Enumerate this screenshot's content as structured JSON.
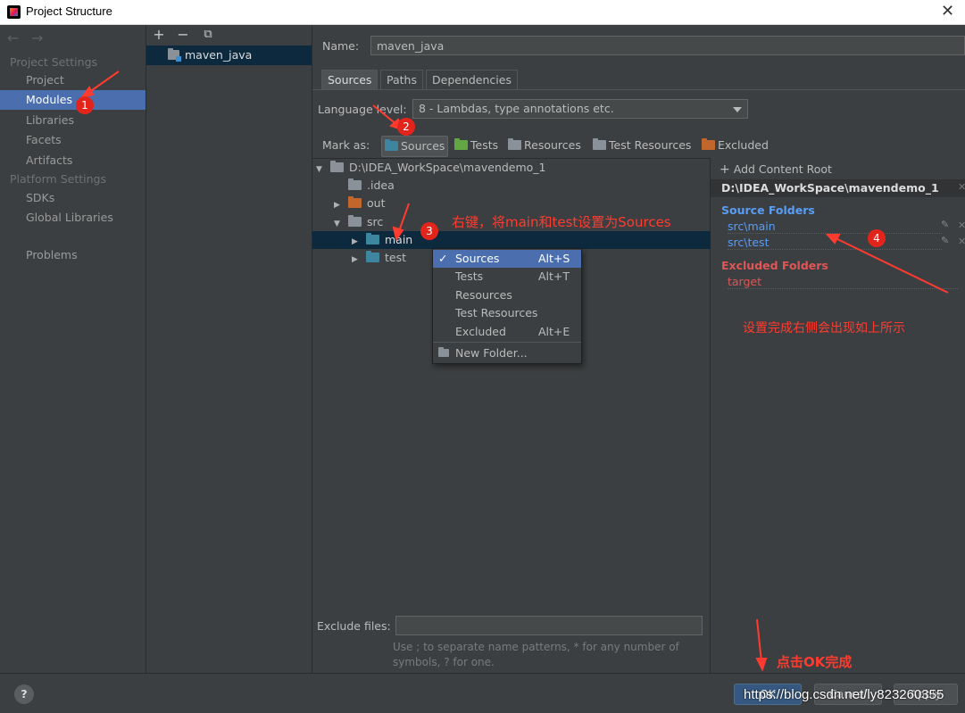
{
  "window": {
    "title": "Project Structure",
    "close_glyph": "✕"
  },
  "nav": {
    "back": "←",
    "forward": "→",
    "project_settings_header": "Project Settings",
    "project_settings_items": [
      "Project",
      "Modules",
      "Libraries",
      "Facets",
      "Artifacts"
    ],
    "platform_settings_header": "Platform Settings",
    "platform_settings_items": [
      "SDKs",
      "Global Libraries"
    ],
    "problems": "Problems",
    "selected": "Modules"
  },
  "modules": {
    "add": "+",
    "remove": "−",
    "copy": "⧉",
    "items": [
      "maven_java"
    ]
  },
  "main": {
    "name_label": "Name:",
    "name_value": "maven_java",
    "tabs": [
      "Sources",
      "Paths",
      "Dependencies"
    ],
    "language_level_label": "Language level:",
    "language_level_value": "8 - Lambdas, type annotations etc.",
    "mark_as_label": "Mark as:",
    "mark_as": [
      "Sources",
      "Tests",
      "Resources",
      "Test Resources",
      "Excluded"
    ],
    "tree": [
      {
        "label": "D:\\IDEA_WorkSpace\\mavendemo_1",
        "toggle": "▼",
        "color": "grey"
      },
      {
        "label": ".idea",
        "toggle": "",
        "color": "grey"
      },
      {
        "label": "out",
        "toggle": "▶",
        "color": "orange"
      },
      {
        "label": "src",
        "toggle": "▼",
        "color": "grey"
      },
      {
        "label": "main",
        "toggle": "▶",
        "color": "blue"
      },
      {
        "label": "test",
        "toggle": "▶",
        "color": "blue"
      }
    ],
    "exclude_label": "Exclude files:",
    "exclude_value": "",
    "exclude_hint_1": "Use ; to separate name patterns, * for any number of",
    "exclude_hint_2": "symbols, ? for one."
  },
  "content_root": {
    "add_label": "Add Content Root",
    "path": "D:\\IDEA_WorkSpace\\mavendemo_1",
    "source_header": "Source Folders",
    "source_items": [
      "src\\main",
      "src\\test"
    ],
    "excluded_header": "Excluded Folders",
    "excluded_items": [
      "target"
    ]
  },
  "context_menu": {
    "items": [
      {
        "label": "Sources",
        "shortcut": "Alt+S",
        "checked": "✓"
      },
      {
        "label": "Tests",
        "shortcut": "Alt+T",
        "checked": ""
      },
      {
        "label": "Resources",
        "shortcut": "",
        "checked": ""
      },
      {
        "label": "Test Resources",
        "shortcut": "",
        "checked": ""
      },
      {
        "label": "Excluded",
        "shortcut": "Alt+E",
        "checked": ""
      }
    ],
    "new_folder": "New Folder..."
  },
  "footer": {
    "help": "?",
    "ok": "OK",
    "cancel": "Cancel",
    "apply": "Apply",
    "watermark": "https://blog.csdn.net/ly823260355"
  },
  "annotations": {
    "badges": [
      "1",
      "2",
      "3",
      "4"
    ],
    "note_right_click": "右键，将main和test设置为Sources",
    "note_result": "设置完成右侧会出现如上所示",
    "note_ok": "点击OK完成",
    "color": "#ff3b30"
  }
}
